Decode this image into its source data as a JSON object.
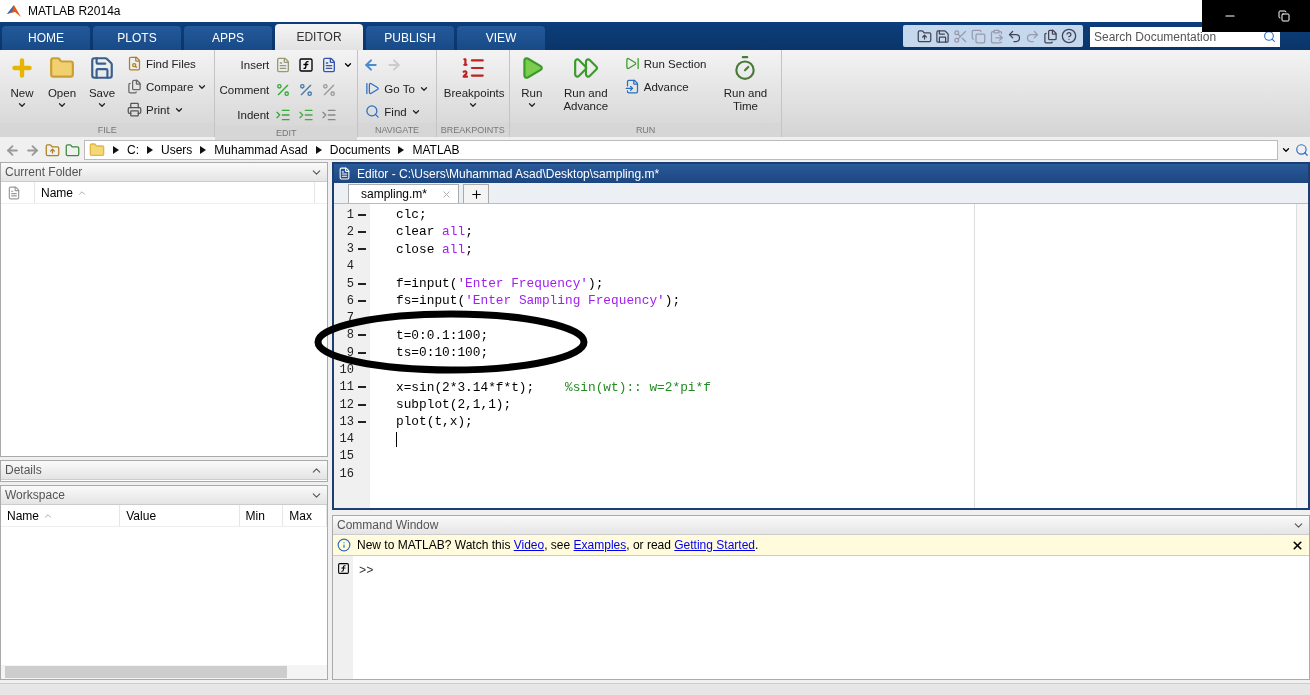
{
  "window": {
    "title": "MATLAB R2014a"
  },
  "tabs": [
    {
      "label": "HOME",
      "selected": false
    },
    {
      "label": "PLOTS",
      "selected": false
    },
    {
      "label": "APPS",
      "selected": false
    },
    {
      "label": "EDITOR",
      "selected": true
    },
    {
      "label": "PUBLISH",
      "selected": false
    },
    {
      "label": "VIEW",
      "selected": false
    }
  ],
  "search": {
    "placeholder": "Search Documentation"
  },
  "ribbon": [
    {
      "label": "FILE",
      "columns": [
        {
          "kind": "large",
          "label": "New",
          "dropdown": true
        },
        {
          "kind": "large",
          "label": "Open",
          "dropdown": true
        },
        {
          "kind": "large",
          "label": "Save",
          "dropdown": true
        },
        {
          "kind": "stack",
          "entries": [
            {
              "label": "Find Files",
              "dropdown": false
            },
            {
              "label": "Compare",
              "dropdown": true
            },
            {
              "label": "Print",
              "dropdown": true
            }
          ]
        }
      ]
    },
    {
      "label": "EDIT",
      "columns": [
        {
          "kind": "rows",
          "entries": [
            {
              "label": "Insert",
              "dropdown": true
            },
            {
              "label": "Comment",
              "dropdown": false
            },
            {
              "label": "Indent",
              "dropdown": false
            }
          ]
        }
      ]
    },
    {
      "label": "NAVIGATE",
      "columns": [
        {
          "kind": "stack",
          "entries": [
            {
              "kind": "arrows"
            },
            {
              "label": "Go To",
              "dropdown": true
            },
            {
              "label": "Find",
              "dropdown": true
            }
          ]
        }
      ]
    },
    {
      "label": "BREAKPOINTS",
      "columns": [
        {
          "kind": "large",
          "label": "Breakpoints",
          "dropdown": true
        }
      ]
    },
    {
      "label": "RUN",
      "columns": [
        {
          "kind": "large",
          "label": "Run",
          "dropdown": true
        },
        {
          "kind": "large",
          "label": "Run and Advance",
          "dropdown": false
        },
        {
          "kind": "stack",
          "entries": [
            {
              "label": "Run Section",
              "dropdown": false
            },
            {
              "label": "Advance",
              "dropdown": false
            }
          ]
        },
        {
          "kind": "large",
          "label": "Run and Time",
          "dropdown": false
        }
      ]
    }
  ],
  "path": [
    "C:",
    "Users",
    "Muhammad Asad",
    "Documents",
    "MATLAB"
  ],
  "current_folder": {
    "title": "Current Folder",
    "columns": [
      {
        "label": "Name",
        "sorted": true
      }
    ]
  },
  "details": {
    "title": "Details"
  },
  "workspace": {
    "title": "Workspace",
    "columns": [
      {
        "label": "Name",
        "sorted": true
      },
      {
        "label": "Value",
        "sorted": false
      },
      {
        "label": "Min",
        "sorted": false
      },
      {
        "label": "Max",
        "sorted": false
      }
    ]
  },
  "editor": {
    "title": "Editor - C:\\Users\\Muhammad Asad\\Desktop\\sampling.m*",
    "tabs": [
      {
        "label": "sampling.m*",
        "selected": true
      }
    ],
    "lines": [
      {
        "number": "1",
        "executable": true,
        "cursor": false,
        "tokens": [
          {
            "text": "clc;",
            "kind": "plain"
          }
        ]
      },
      {
        "number": "2",
        "executable": true,
        "cursor": false,
        "tokens": [
          {
            "text": "clear ",
            "kind": "plain"
          },
          {
            "text": "all",
            "kind": "string"
          },
          {
            "text": ";",
            "kind": "plain"
          }
        ]
      },
      {
        "number": "3",
        "executable": true,
        "cursor": false,
        "tokens": [
          {
            "text": "close ",
            "kind": "plain"
          },
          {
            "text": "all",
            "kind": "string"
          },
          {
            "text": ";",
            "kind": "plain"
          }
        ]
      },
      {
        "number": "4",
        "executable": false,
        "cursor": false
      },
      {
        "number": "5",
        "executable": true,
        "cursor": false,
        "tokens": [
          {
            "text": "f=input(",
            "kind": "plain"
          },
          {
            "text": "'Enter Frequency'",
            "kind": "string"
          },
          {
            "text": ");",
            "kind": "plain"
          }
        ]
      },
      {
        "number": "6",
        "executable": true,
        "cursor": false,
        "tokens": [
          {
            "text": "fs=input(",
            "kind": "plain"
          },
          {
            "text": "'Enter Sampling Frequency'",
            "kind": "string"
          },
          {
            "text": ");",
            "kind": "plain"
          }
        ]
      },
      {
        "number": "7",
        "executable": false,
        "cursor": false
      },
      {
        "number": "8",
        "executable": true,
        "cursor": false,
        "tokens": [
          {
            "text": "t=0:0.1:100;",
            "kind": "plain"
          }
        ]
      },
      {
        "number": "9",
        "executable": true,
        "cursor": false,
        "tokens": [
          {
            "text": "ts=0:10:100;",
            "kind": "plain"
          }
        ]
      },
      {
        "number": "10",
        "executable": false,
        "cursor": false
      },
      {
        "number": "11",
        "executable": true,
        "cursor": false,
        "tokens": [
          {
            "text": "x=sin(2*3.14*f*t);    ",
            "kind": "plain"
          },
          {
            "text": "%sin(wt):: w=2*pi*f",
            "kind": "comment"
          }
        ]
      },
      {
        "number": "12",
        "executable": true,
        "cursor": false,
        "tokens": [
          {
            "text": "subplot(2,1,1);",
            "kind": "plain"
          }
        ]
      },
      {
        "number": "13",
        "executable": true,
        "cursor": false,
        "tokens": [
          {
            "text": "plot(t,x);",
            "kind": "plain"
          }
        ]
      },
      {
        "number": "14",
        "executable": false,
        "cursor": true
      },
      {
        "number": "15",
        "executable": false,
        "cursor": false
      },
      {
        "number": "16",
        "executable": false,
        "cursor": false
      }
    ]
  },
  "command_window": {
    "title": "Command Window",
    "banner": [
      {
        "text": "New to MATLAB? Watch this ",
        "kind": "text"
      },
      {
        "text": "Video",
        "kind": "link"
      },
      {
        "text": ", see ",
        "kind": "text"
      },
      {
        "text": "Examples",
        "kind": "link"
      },
      {
        "text": ", or read ",
        "kind": "text"
      },
      {
        "text": "Getting Started",
        "kind": "link"
      },
      {
        "text": ".",
        "kind": "text"
      }
    ],
    "prompt": ">>"
  }
}
